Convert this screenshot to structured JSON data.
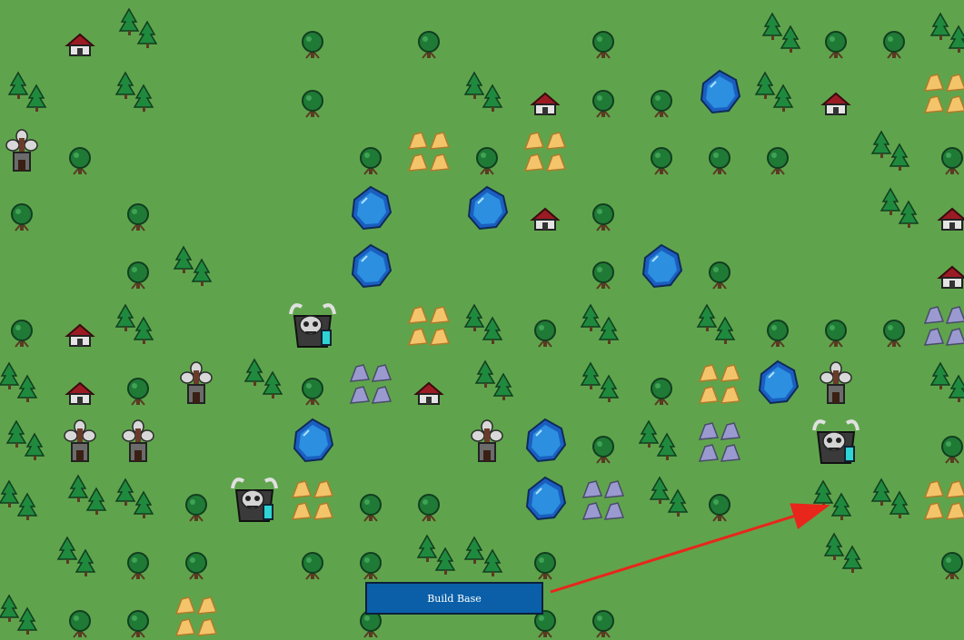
{
  "ui": {
    "build_button_label": "Build Base"
  },
  "colors": {
    "grass": "#5fa44c",
    "button": "#0a5fa8",
    "arrow": "#e8261b"
  },
  "icons": {
    "tree": "tree-icon",
    "pine": "pine-trees-icon",
    "hut": "hut-icon",
    "tower": "tower-icon",
    "lake": "lake-icon",
    "gold": "gold-ore-icon",
    "stone": "stone-ore-icon",
    "enemy": "enemy-skull-base-icon"
  }
}
